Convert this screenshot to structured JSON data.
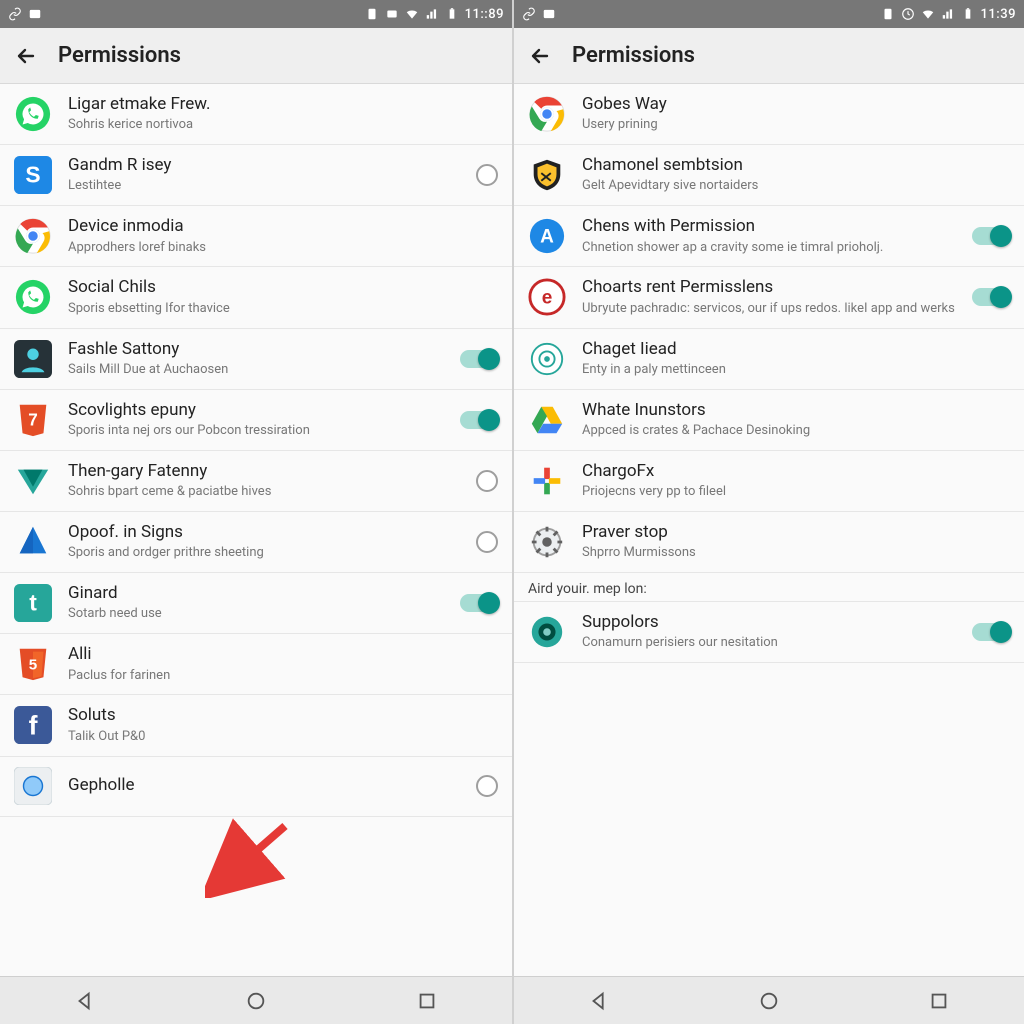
{
  "left": {
    "status_time": "11::89",
    "title": "Permissions",
    "items": [
      {
        "title": "Ligar etmake Frew.",
        "sub": "Sohris kerice nortivoa",
        "icon": "whatsapp",
        "control": "none"
      },
      {
        "title": "Gandm R isey",
        "sub": "Lestihtee",
        "icon": "s-blue",
        "control": "radio"
      },
      {
        "title": "Device inmodia",
        "sub": "Approdhers loref binaks",
        "icon": "chrome",
        "control": "none"
      },
      {
        "title": "Social Chils",
        "sub": "Sporis ebsetting Ifor thavice",
        "icon": "whatsapp",
        "control": "none"
      },
      {
        "title": "Fashle Sattony",
        "sub": "Sails Mill Due at Auchaosen",
        "icon": "contact-dark",
        "control": "toggle-on"
      },
      {
        "title": "Scovlights epuny",
        "sub": "Sporis inta nej ors our Pobcon tressiration",
        "icon": "html7",
        "control": "toggle-on"
      },
      {
        "title": "Then-gary Fatenny",
        "sub": "Sohris bpart ceme & paciatbe hives",
        "icon": "v-teal",
        "control": "radio"
      },
      {
        "title": "Opoof. in Signs",
        "sub": "Sporis and ordger prithre sheeting",
        "icon": "nav-blue",
        "control": "radio"
      },
      {
        "title": "Ginard",
        "sub": "Sotarb need use",
        "icon": "t-teal",
        "control": "toggle-on"
      },
      {
        "title": "Alli",
        "sub": "Paclus for farinen",
        "icon": "html5",
        "control": "none"
      },
      {
        "title": "Soluts",
        "sub": "Talik Out P&0",
        "icon": "facebook",
        "control": "none"
      },
      {
        "title": "Gepholle",
        "sub": "",
        "icon": "globe-grey",
        "control": "radio"
      }
    ]
  },
  "right": {
    "status_time": "11:39",
    "title": "Permissions",
    "section_label": "Aird youir. mep lon:",
    "items": [
      {
        "title": "Gobes Way",
        "sub": "Usery prining",
        "icon": "chrome",
        "control": "none"
      },
      {
        "title": "Chamonel sembtsion",
        "sub": "Gelt Apevidtary sive nortaiders",
        "icon": "shield-gold",
        "control": "none"
      },
      {
        "title": "Chens with Permission",
        "sub": "Chnetion shower ap a cravity some ie timral prioholj.",
        "icon": "appstore",
        "control": "toggle-on"
      },
      {
        "title": "Choarts rent Permisslens",
        "sub": "Ubryute pachradıc: servicos, our if ups redos. likeI app and werks",
        "icon": "e-red",
        "control": "toggle-on"
      },
      {
        "title": "Chaget Iiead",
        "sub": "Enty in a paly mettinceen",
        "icon": "target-teal",
        "control": "none"
      },
      {
        "title": "Whate Inunstors",
        "sub": "Appced is crates & Pachace Desinoking",
        "icon": "drive",
        "control": "none"
      },
      {
        "title": "ChargoFx",
        "sub": "Priojecns very pp to fileel",
        "icon": "plus-multi",
        "control": "none"
      },
      {
        "title": "Praver stop",
        "sub": "Shprro Murmissons",
        "icon": "gear-grey",
        "control": "none"
      }
    ],
    "section_items": [
      {
        "title": "Suppolors",
        "sub": "Conamurn perisiers our nesitation",
        "icon": "circle-teal",
        "control": "toggle-on"
      }
    ]
  }
}
